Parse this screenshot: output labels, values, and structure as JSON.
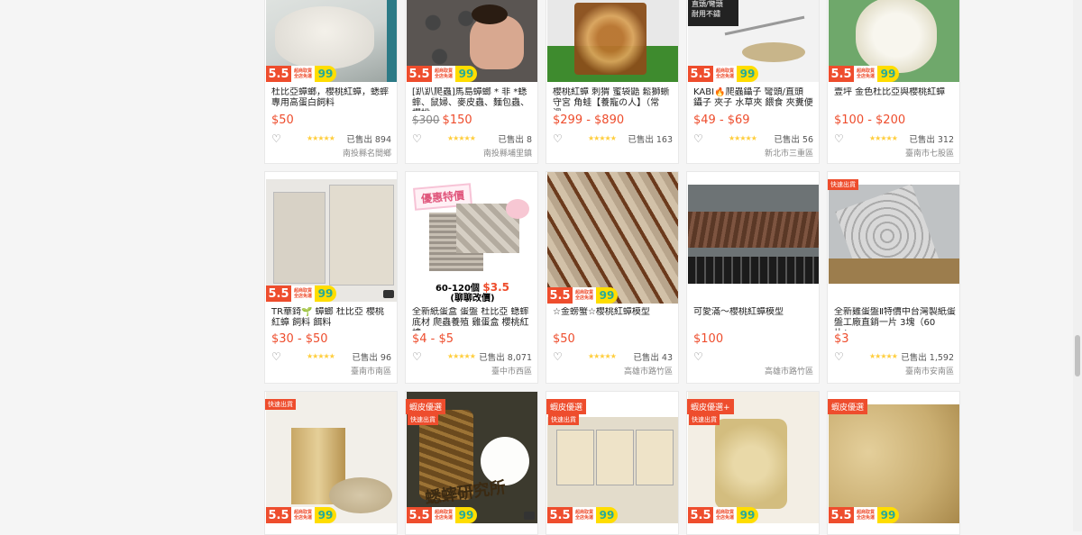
{
  "products": [
    {
      "title": "杜比亞蟑螂，櫻桃紅蟑，蟋蟀專用高蛋白飼料",
      "orig_price": "",
      "price": "$50",
      "sold": "已售出 894",
      "location": "南投縣名間鄉",
      "promo": true,
      "fast": false,
      "mall": ""
    },
    {
      "title": "[趴趴爬蟲]馬島蟑螂 * 非 *蟋蟀、鼠婦、麥皮蟲、麵包蟲、櫻桃...",
      "orig_price": "$300",
      "price": "$150",
      "sold": "已售出 8",
      "location": "南投縣埔里鎮",
      "promo": true,
      "fast": false,
      "mall": ""
    },
    {
      "title": "櫻桃紅蟑 刺猬 蜜袋鼯 鬆獅蜥 守宮 角蛙【養寵の人】（常溫...",
      "orig_price": "",
      "price": "$299 - $890",
      "sold": "已售出 163",
      "location": "",
      "promo": false,
      "fast": false,
      "mall": ""
    },
    {
      "title": "KABI🔥爬蟲鑷子 彎頭/直頭 鑷子 夾子 水草夾 餵食 夾糞便 ...",
      "orig_price": "",
      "price": "$49 - $69",
      "sold": "已售出 56",
      "location": "新北市三重區",
      "promo": true,
      "fast": false,
      "mall": ""
    },
    {
      "title": "壹坪 金色杜比亞與櫻桃紅蟑",
      "orig_price": "",
      "price": "$100 - $200",
      "sold": "已售出 312",
      "location": "臺南市七股區",
      "promo": true,
      "fast": false,
      "mall": ""
    },
    {
      "title": "TR華錡🌱 蟑螂 杜比亞 櫻桃紅蟑 飼料 餌料",
      "orig_price": "",
      "price": "$30 - $50",
      "sold": "已售出 96",
      "location": "臺南市南區",
      "promo": true,
      "fast": false,
      "mall": ""
    },
    {
      "title": "全新紙蛋盒 蛋盤 杜比亞 蟋蟀底材 爬蟲養殖 雞蛋盒 櫻桃紅蟑...",
      "orig_price": "",
      "price": "$4 - $5",
      "sold": "已售出 8,071",
      "location": "臺中市西區",
      "promo": false,
      "fast": false,
      "mall": ""
    },
    {
      "title": "☆金螃蟹☆櫻桃紅蟑模型",
      "orig_price": "",
      "price": "$50",
      "sold": "已售出 43",
      "location": "高雄市路竹區",
      "promo": true,
      "fast": false,
      "mall": ""
    },
    {
      "title": "可愛滿～櫻桃紅蟑模型",
      "orig_price": "",
      "price": "$100",
      "sold": "",
      "location": "高雄市路竹區",
      "promo": false,
      "fast": false,
      "mall": ""
    },
    {
      "title": "全新雞蛋盤Ⅱ特價中台灣製紙蛋盤工廠直銷一片 3塊（60片/...",
      "orig_price": "",
      "price": "$3",
      "sold": "已售出 1,592",
      "location": "臺南市安南區",
      "promo": false,
      "fast": true,
      "mall": ""
    },
    {
      "title": "",
      "orig_price": "",
      "price": "",
      "sold": "",
      "location": "",
      "promo": true,
      "fast": true,
      "mall": ""
    },
    {
      "title": "",
      "orig_price": "",
      "price": "",
      "sold": "",
      "location": "",
      "promo": true,
      "fast": true,
      "mall": "蝦皮優選"
    },
    {
      "title": "",
      "orig_price": "",
      "price": "",
      "sold": "",
      "location": "",
      "promo": true,
      "fast": true,
      "mall": "蝦皮優選"
    },
    {
      "title": "",
      "orig_price": "",
      "price": "",
      "sold": "",
      "location": "",
      "promo": true,
      "fast": true,
      "mall": "蝦皮優選+"
    },
    {
      "title": "",
      "orig_price": "",
      "price": "",
      "sold": "",
      "location": "",
      "promo": true,
      "fast": false,
      "mall": "蝦皮優選"
    }
  ],
  "promo": {
    "big": "5.5",
    "line1": "超商取貨",
    "line2": "全店免運",
    "num": "99"
  },
  "labels": {
    "fast": "快速出貨",
    "coupon": "優惠特價",
    "egg1": "60-120個",
    "egg_price": "$3.5",
    "egg2": "(聊聊改價)",
    "brand": "蟋蟀研究所"
  },
  "product_images": {
    "tweezer_note1": "直頭/彎頭",
    "tweezer_note2": "耐用不鏽"
  },
  "icons": {
    "heart": "heart-icon",
    "star": "star-icon",
    "video": "video-icon"
  },
  "colors": {
    "brand": "#ee4d2d",
    "stars": "#ffce3d"
  }
}
